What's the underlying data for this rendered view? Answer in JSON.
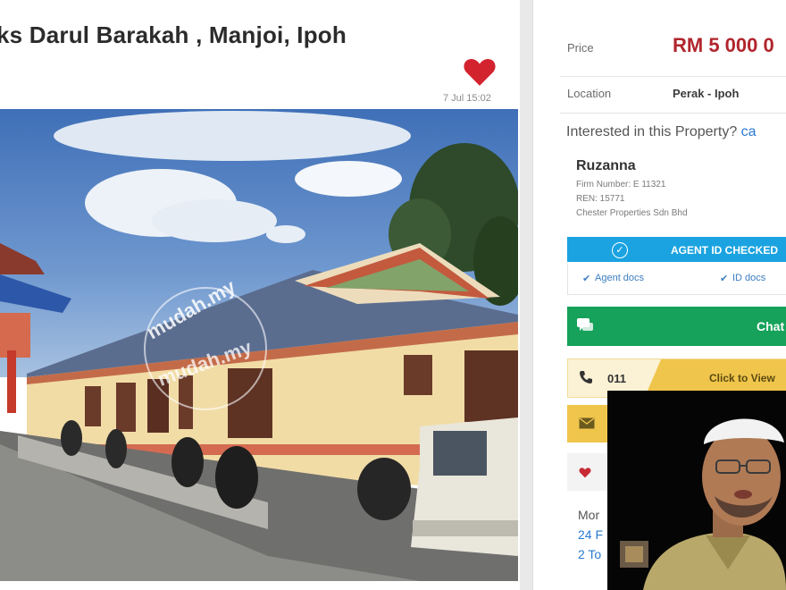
{
  "listing": {
    "title": "ks Darul Barakah , Manjoi, Ipoh",
    "date": "7 Jul 15:02",
    "watermark": "mudah.my"
  },
  "sidebar": {
    "price_label": "Price",
    "price_value": "RM 5 000 0",
    "location_label": "Location",
    "location_value": "Perak - Ipoh",
    "interest_text": "Interested in this Property?",
    "interest_link": "ca",
    "agent": {
      "name": "Ruzanna",
      "firm": "Firm Number: E 11321",
      "ren": "REN: 15771",
      "company": "Chester Properties Sdn Bhd"
    },
    "agent_check_label": "AGENT ID CHECKED",
    "agent_docs_label": "Agent docs",
    "id_docs_label": "ID docs",
    "chat_label": "Chat",
    "phone_prefix": "011",
    "click_to_view_label": "Click to View",
    "more_label": "Mor",
    "more_line1": "24 F",
    "more_line2": "2 To"
  },
  "colors": {
    "price": "#b1252d",
    "heart": "#d3232f",
    "agent_bar": "#1aa3e0",
    "chat": "#16a25a",
    "phone_accent": "#f0c54c"
  },
  "icons": [
    "heart-icon",
    "check-circle-icon",
    "chat-icon",
    "phone-icon",
    "mail-icon",
    "heart-small-icon"
  ]
}
